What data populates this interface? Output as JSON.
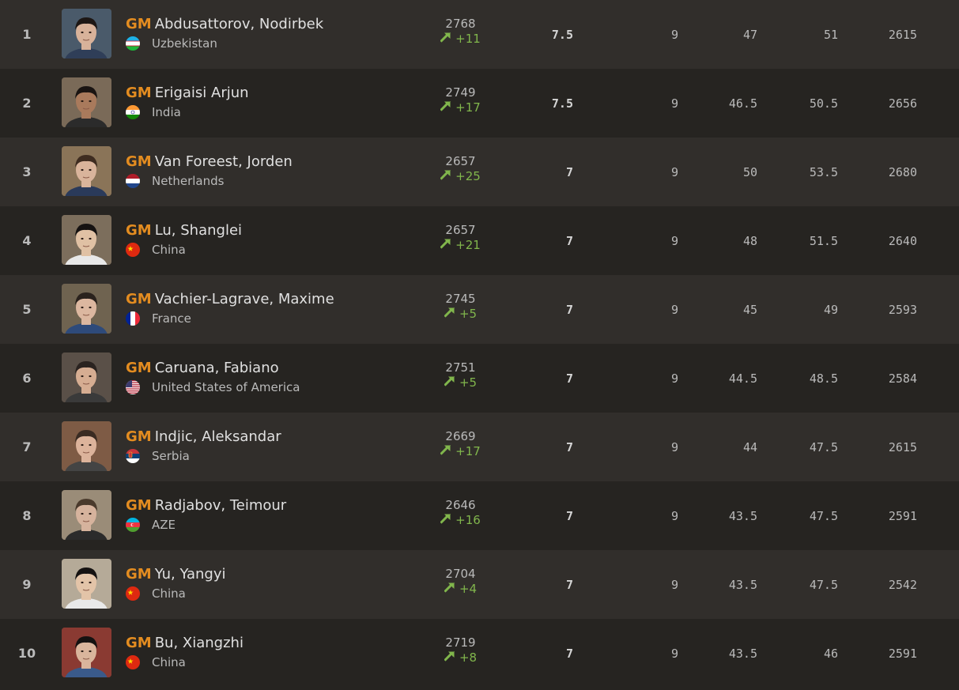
{
  "standings": {
    "rows": [
      {
        "rank": "1",
        "title": "GM",
        "name": "Abdusattorov, Nodirbek",
        "country": "Uzbekistan",
        "flag": "uz",
        "rating": "2768",
        "change": "+11",
        "points": "7.5",
        "games": "9",
        "tb1": "47",
        "tb2": "51",
        "performance": "2615",
        "avatar_bg": "#4a5a6a",
        "skin": "#d8b29a",
        "hair": "#1d1715",
        "shirt": "#2f3e58"
      },
      {
        "rank": "2",
        "title": "GM",
        "name": "Erigaisi Arjun",
        "country": "India",
        "flag": "in",
        "rating": "2749",
        "change": "+17",
        "points": "7.5",
        "games": "9",
        "tb1": "46.5",
        "tb2": "50.5",
        "performance": "2656",
        "avatar_bg": "#7a6a58",
        "skin": "#a97a5c",
        "hair": "#1a1412",
        "shirt": "#2b2b2b"
      },
      {
        "rank": "3",
        "title": "GM",
        "name": "Van Foreest, Jorden",
        "country": "Netherlands",
        "flag": "nl",
        "rating": "2657",
        "change": "+25",
        "points": "7",
        "games": "9",
        "tb1": "50",
        "tb2": "53.5",
        "performance": "2680",
        "avatar_bg": "#8a7458",
        "skin": "#d9b49b",
        "hair": "#3e2c20",
        "shirt": "#2a3a5a"
      },
      {
        "rank": "4",
        "title": "GM",
        "name": "Lu, Shanglei",
        "country": "China",
        "flag": "cn",
        "rating": "2657",
        "change": "+21",
        "points": "7",
        "games": "9",
        "tb1": "48",
        "tb2": "51.5",
        "performance": "2640",
        "avatar_bg": "#7c6e5c",
        "skin": "#e0c1a4",
        "hair": "#151211",
        "shirt": "#e8e8e8"
      },
      {
        "rank": "5",
        "title": "GM",
        "name": "Vachier-Lagrave, Maxime",
        "country": "France",
        "flag": "fr",
        "rating": "2745",
        "change": "+5",
        "points": "7",
        "games": "9",
        "tb1": "45",
        "tb2": "49",
        "performance": "2593",
        "avatar_bg": "#6f6350",
        "skin": "#dcb7a0",
        "hair": "#2a221d",
        "shirt": "#2e4a7a"
      },
      {
        "rank": "6",
        "title": "GM",
        "name": "Caruana, Fabiano",
        "country": "United States of America",
        "flag": "us",
        "rating": "2751",
        "change": "+5",
        "points": "7",
        "games": "9",
        "tb1": "44.5",
        "tb2": "48.5",
        "performance": "2584",
        "avatar_bg": "#5a5048",
        "skin": "#d6ad92",
        "hair": "#2a2320",
        "shirt": "#3a3a3a"
      },
      {
        "rank": "7",
        "title": "GM",
        "name": "Indjic, Aleksandar",
        "country": "Serbia",
        "flag": "rs",
        "rating": "2669",
        "change": "+17",
        "points": "7",
        "games": "9",
        "tb1": "44",
        "tb2": "47.5",
        "performance": "2615",
        "avatar_bg": "#7e5b45",
        "skin": "#dcb39b",
        "hair": "#3a2b22",
        "shirt": "#444444"
      },
      {
        "rank": "8",
        "title": "GM",
        "name": "Radjabov, Teimour",
        "country": "AZE",
        "flag": "az",
        "rating": "2646",
        "change": "+16",
        "points": "7",
        "games": "9",
        "tb1": "43.5",
        "tb2": "47.5",
        "performance": "2591",
        "avatar_bg": "#9a8c78",
        "skin": "#d6b39d",
        "hair": "#4a3a2c",
        "shirt": "#2b2b2b"
      },
      {
        "rank": "9",
        "title": "GM",
        "name": "Yu, Yangyi",
        "country": "China",
        "flag": "cn",
        "rating": "2704",
        "change": "+4",
        "points": "7",
        "games": "9",
        "tb1": "43.5",
        "tb2": "47.5",
        "performance": "2542",
        "avatar_bg": "#b5aa98",
        "skin": "#e3c4a8",
        "hair": "#151211",
        "shirt": "#e9e9e9"
      },
      {
        "rank": "10",
        "title": "GM",
        "name": "Bu, Xiangzhi",
        "country": "China",
        "flag": "cn",
        "rating": "2719",
        "change": "+8",
        "points": "7",
        "games": "9",
        "tb1": "43.5",
        "tb2": "46",
        "performance": "2591",
        "avatar_bg": "#8a3a32",
        "skin": "#d9b59c",
        "hair": "#151211",
        "shirt": "#3a5a8a"
      }
    ]
  },
  "colors": {
    "title_badge": "#e38c20",
    "rating_up": "#81b64c",
    "row_odd": "#312e2b",
    "row_even": "#262421"
  },
  "icons": {
    "rating_change": "trend-up-arrow-icon"
  }
}
